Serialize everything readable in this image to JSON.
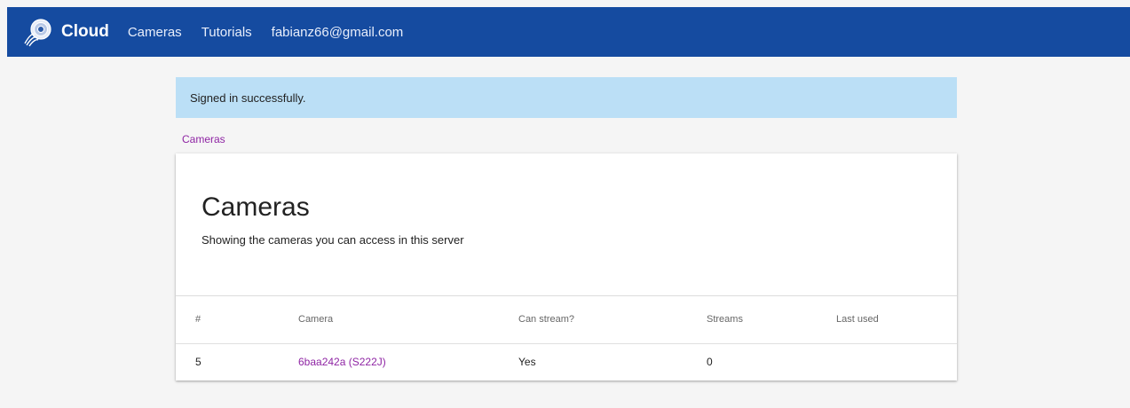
{
  "navbar": {
    "brand": "Cloud",
    "links": [
      "Cameras",
      "Tutorials",
      "fabianz66@gmail.com"
    ],
    "background": "#154ba0"
  },
  "alert": {
    "message": "Signed in successfully.",
    "background": "#bbdff6"
  },
  "breadcrumb": {
    "label": "Cameras",
    "color": "#8f25a4"
  },
  "card": {
    "title": "Cameras",
    "subtitle": "Showing the cameras you can access in this server"
  },
  "table": {
    "headers": [
      "#",
      "Camera",
      "Can stream?",
      "Streams",
      "Last used"
    ],
    "rows": [
      {
        "id": "5",
        "camera": "6baa242a (S222J)",
        "can_stream": "Yes",
        "streams": "0",
        "last_used": ""
      }
    ]
  }
}
